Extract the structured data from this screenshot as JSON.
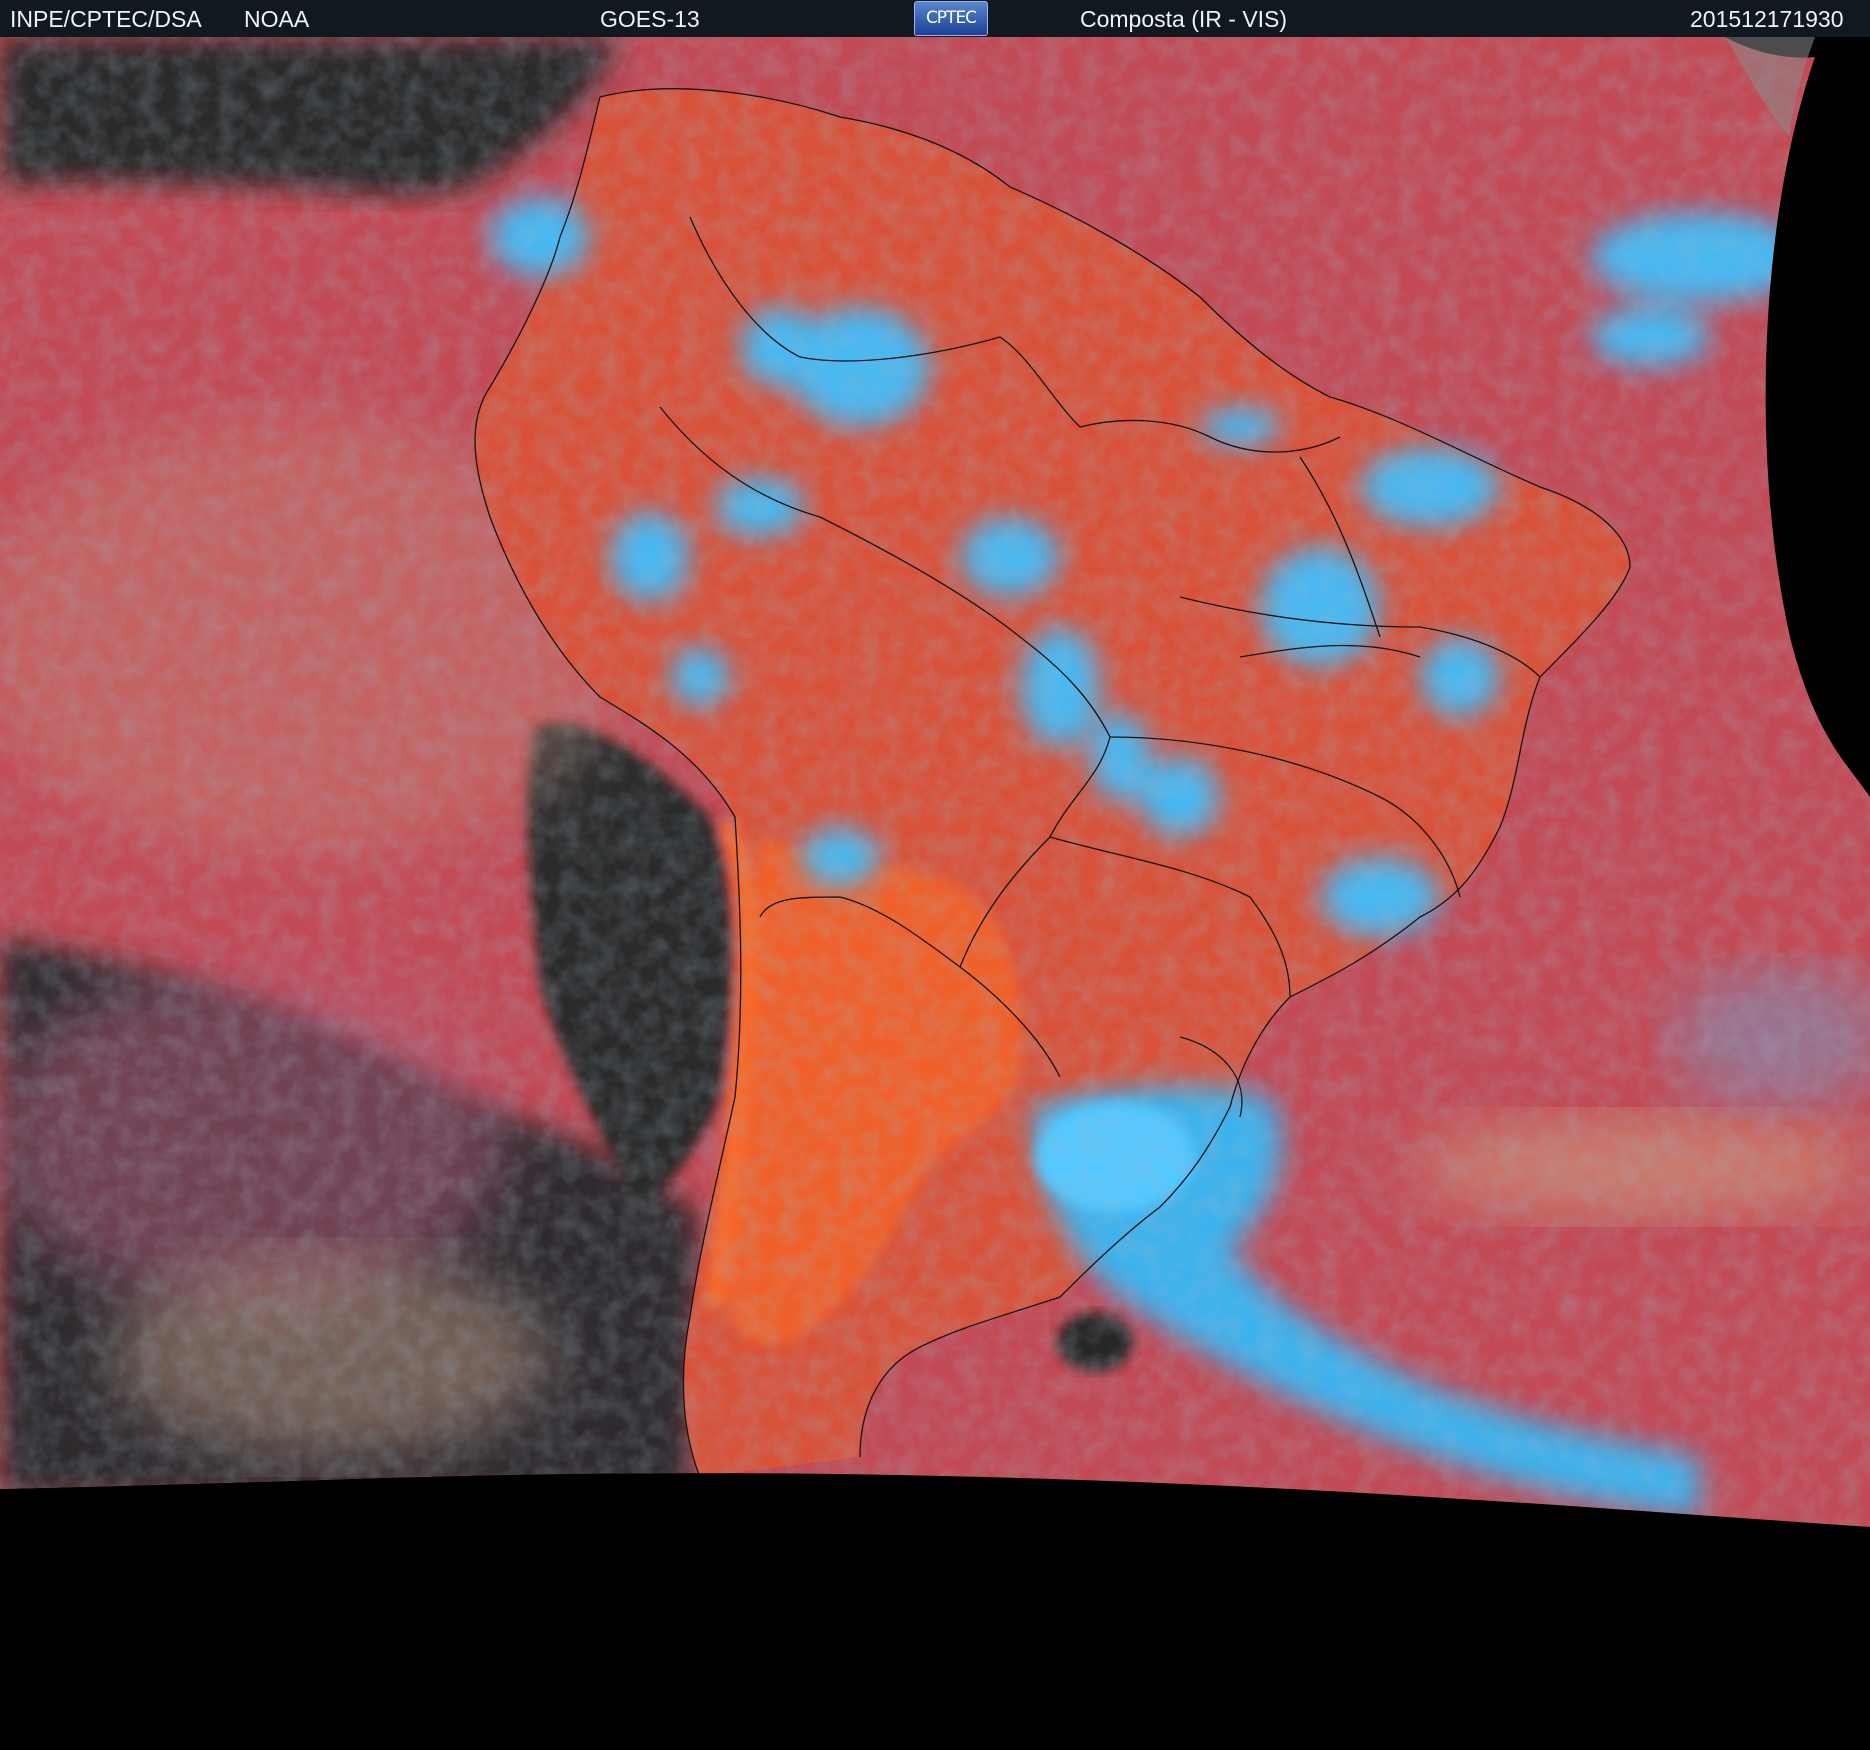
{
  "header": {
    "source": "INPE/CPTEC/DSA",
    "agency": "NOAA",
    "satellite": "GOES-13",
    "logo_text": "CPTEC",
    "product": "Composta (IR - VIS)",
    "timestamp": "201512171930"
  },
  "colors": {
    "header_bg": "#101820",
    "ocean_clear": "#c24a55",
    "land_clear": "#e25b30",
    "high_cloud": "#3fb6f0",
    "low_cloud": "#c9a07a",
    "no_data": "#000000",
    "dark_ocean": "#2a2a2a",
    "borders": "#111111"
  },
  "icons": [
    "cptec-logo"
  ]
}
